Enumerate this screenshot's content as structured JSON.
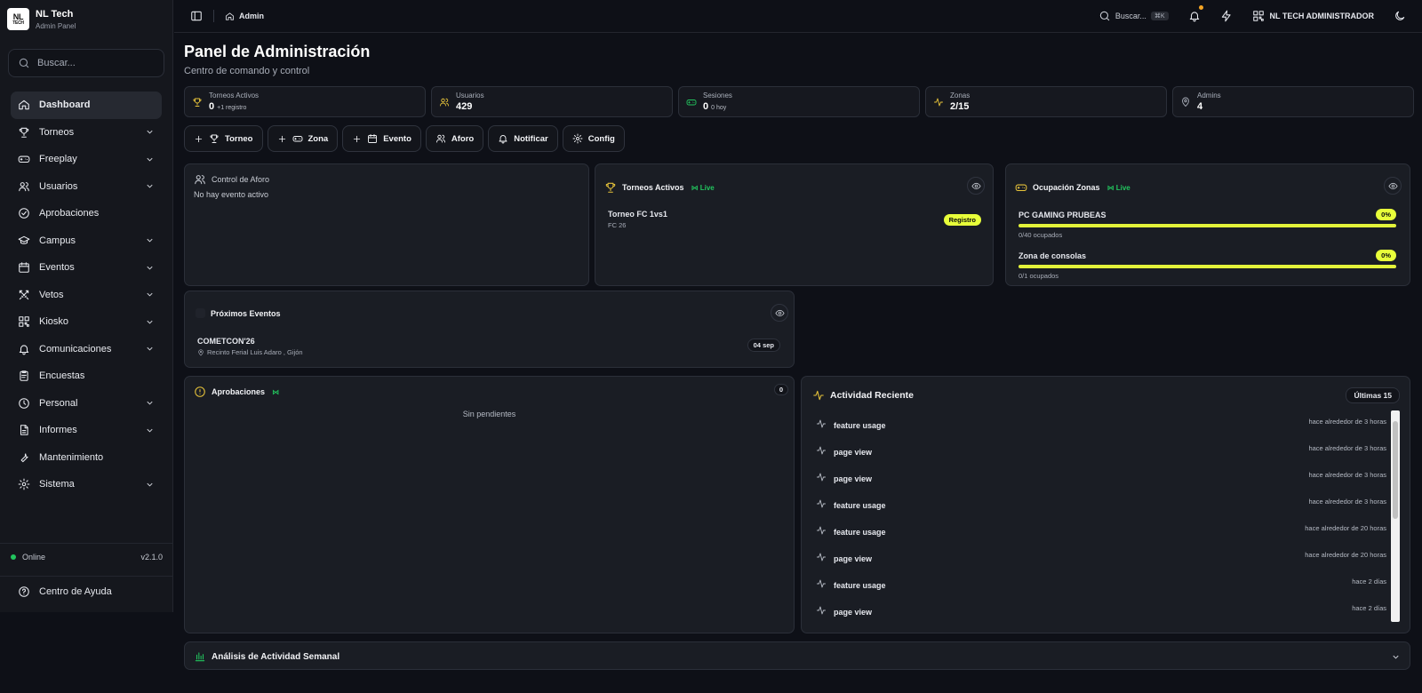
{
  "brand": {
    "name": "NL Tech",
    "sub": "Admin Panel",
    "logo_top": "NL",
    "logo_bottom": "TECH"
  },
  "sidebar": {
    "search_placeholder": "Buscar...",
    "items": [
      {
        "label": "Dashboard",
        "icon": "home-icon",
        "active": true
      },
      {
        "label": "Torneos",
        "icon": "trophy-icon",
        "expandable": true
      },
      {
        "label": "Freeplay",
        "icon": "gamepad-icon",
        "expandable": true
      },
      {
        "label": "Usuarios",
        "icon": "users-icon",
        "expandable": true
      },
      {
        "label": "Aprobaciones",
        "icon": "check-circle-icon"
      },
      {
        "label": "Campus",
        "icon": "graduation-cap-icon",
        "expandable": true
      },
      {
        "label": "Eventos",
        "icon": "calendar-icon",
        "expandable": true
      },
      {
        "label": "Vetos",
        "icon": "swords-icon",
        "expandable": true
      },
      {
        "label": "Kiosko",
        "icon": "qr-code-icon",
        "expandable": true
      },
      {
        "label": "Comunicaciones",
        "icon": "bell-icon",
        "expandable": true
      },
      {
        "label": "Encuestas",
        "icon": "clipboard-icon"
      },
      {
        "label": "Personal",
        "icon": "clock-icon",
        "expandable": true
      },
      {
        "label": "Informes",
        "icon": "file-icon",
        "expandable": true
      },
      {
        "label": "Mantenimiento",
        "icon": "wrench-icon"
      },
      {
        "label": "Sistema",
        "icon": "gear-icon",
        "expandable": true
      }
    ],
    "status": "Online",
    "version": "v2.1.0",
    "help": "Centro de Ayuda"
  },
  "topbar": {
    "breadcrumb": "Admin",
    "search": "Buscar...",
    "shortcut": "⌘K",
    "user": "NL TECH ADMINISTRADOR"
  },
  "page": {
    "title": "Panel de Administración",
    "subtitle": "Centro de comando y control"
  },
  "stats": [
    {
      "label": "Torneos Activos",
      "value": "0",
      "extra": "+1 registro",
      "icon": "trophy-icon",
      "color": "#e8c43a"
    },
    {
      "label": "Usuarios",
      "value": "429",
      "extra": "",
      "icon": "users-icon",
      "color": "#e8c43a"
    },
    {
      "label": "Sesiones",
      "value": "0",
      "extra": "0 hoy",
      "icon": "gamepad-icon",
      "color": "#22c55e"
    },
    {
      "label": "Zonas",
      "value": "2/15",
      "extra": "",
      "icon": "activity-icon",
      "color": "#e8c43a"
    },
    {
      "label": "Admins",
      "value": "4",
      "extra": "",
      "icon": "map-pin-icon",
      "color": "#a8adb8"
    }
  ],
  "actions": [
    "Torneo",
    "Zona",
    "Evento",
    "Aforo",
    "Notificar",
    "Config"
  ],
  "aforo": {
    "title": "Control de Aforo",
    "empty": "No hay evento activo"
  },
  "torneos": {
    "title": "Torneos Activos",
    "live": "Live",
    "item_name": "Torneo FC 1vs1",
    "item_game": "FC 26",
    "item_status": "Registro"
  },
  "zonas": {
    "title": "Ocupación Zonas",
    "live": "Live",
    "items": [
      {
        "name": "PC GAMING PRUBEAS",
        "pct": "0%",
        "occ": "0/40 ocupados",
        "level": 0
      },
      {
        "name": "Zona de consolas",
        "pct": "0%",
        "occ": "0/1 ocupados",
        "level": 0
      }
    ]
  },
  "eventos": {
    "title": "Próximos Eventos",
    "name": "COMETCON'26",
    "place": "Recinto Ferial Luis Adaro , Gijón",
    "date": "04 sep"
  },
  "aprobaciones": {
    "title": "Aprobaciones",
    "count": "0",
    "empty": "Sin pendientes"
  },
  "actividad": {
    "title": "Actividad Reciente",
    "badge": "Últimas 15",
    "items": [
      {
        "name": "feature usage",
        "time": "hace alrededor de 3 horas"
      },
      {
        "name": "page view",
        "time": "hace alrededor de 3 horas"
      },
      {
        "name": "page view",
        "time": "hace alrededor de 3 horas"
      },
      {
        "name": "feature usage",
        "time": "hace alrededor de 3 horas"
      },
      {
        "name": "feature usage",
        "time": "hace alrededor de 20 horas"
      },
      {
        "name": "page view",
        "time": "hace alrededor de 20 horas"
      },
      {
        "name": "feature usage",
        "time": "hace 2 días"
      },
      {
        "name": "page view",
        "time": "hace 2 días"
      }
    ]
  },
  "analisis": {
    "title": "Análisis de Actividad Semanal"
  },
  "colors": {
    "accent": "#e8ff3a",
    "live": "#22c55e",
    "bg": "#0e1017",
    "card": "#1a1d24"
  }
}
